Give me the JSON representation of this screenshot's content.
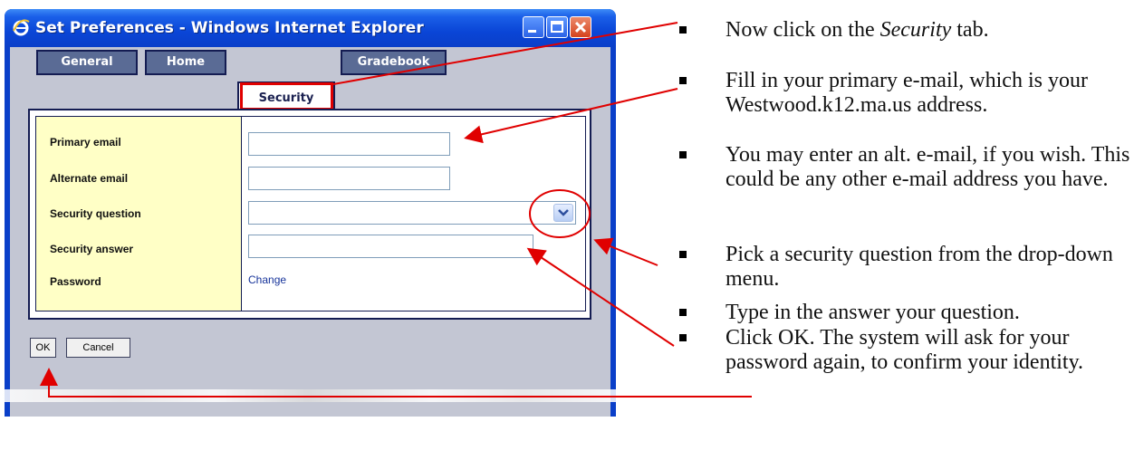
{
  "window": {
    "title": "Set Preferences - Windows Internet Explorer",
    "icon": "internet-explorer-icon"
  },
  "tabs": [
    {
      "label": "General",
      "active": false
    },
    {
      "label": "Home",
      "active": false
    },
    {
      "label": "Security",
      "active": true
    },
    {
      "label": "Gradebook",
      "active": false
    }
  ],
  "form": {
    "primary_email": {
      "label": "Primary email",
      "value": ""
    },
    "alternate_email": {
      "label": "Alternate email",
      "value": ""
    },
    "security_question": {
      "label": "Security question",
      "value": ""
    },
    "security_answer": {
      "label": "Security answer",
      "value": ""
    },
    "password": {
      "label": "Password",
      "link": "Change"
    }
  },
  "buttons": {
    "ok": "OK",
    "cancel": "Cancel"
  },
  "instructions": [
    {
      "pre": "Now click on the ",
      "emph": "Security",
      "post": " tab."
    },
    {
      "text": "Fill in your primary e-mail, which is your Westwood.k12.ma.us address."
    },
    {
      "text": "You may enter an alt. e-mail, if you wish.  This could be any other e-mail address you have."
    },
    {
      "text": "Pick a security question from the drop-down menu."
    },
    {
      "text": "Type in the answer your question."
    },
    {
      "text": "Click OK.  The system will ask for your password again, to confirm your identity."
    }
  ],
  "colors": {
    "titlebar": "#0a45d6",
    "tab": "#5a6b95",
    "label_column": "#ffffc6",
    "annotation_red": "#e00000"
  }
}
